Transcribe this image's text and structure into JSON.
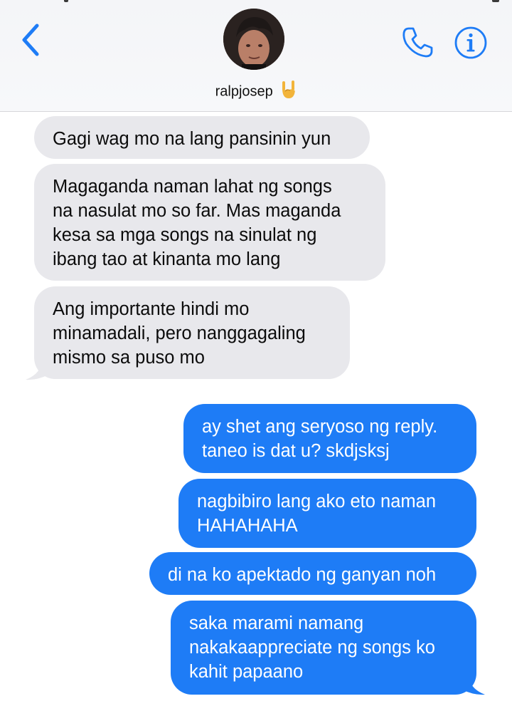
{
  "header": {
    "back_icon": "chevron-left-icon",
    "contact_name": "ralpjosep",
    "contact_emoji": "🤘",
    "call_icon": "phone-icon",
    "info_icon": "info-icon",
    "accent_color": "#1e7cf6"
  },
  "messages": {
    "incoming": [
      {
        "text": "Gagi wag mo na lang pansinin yun"
      },
      {
        "text": "Magaganda naman lahat ng songs\nna nasulat mo so far. Mas maganda\nkesa sa mga songs na sinulat ng\nibang tao at kinanta mo lang"
      },
      {
        "text": "Ang importante hindi mo\nminamadali, pero nanggagaling\nmismo sa puso mo"
      }
    ],
    "outgoing": [
      {
        "text": "ay shet ang seryoso ng reply.\ntaneo is dat u? skdjsksj"
      },
      {
        "text": "nagbibiro lang ako eto naman\nHAHAHAHA"
      },
      {
        "text": "di na ko apektado ng ganyan noh"
      },
      {
        "text": "saka marami namang\nnakakaappreciate ng songs ko\nkahit papaano"
      }
    ],
    "incoming_color": "#e8e8ec",
    "outgoing_color": "#1e7cf6"
  }
}
